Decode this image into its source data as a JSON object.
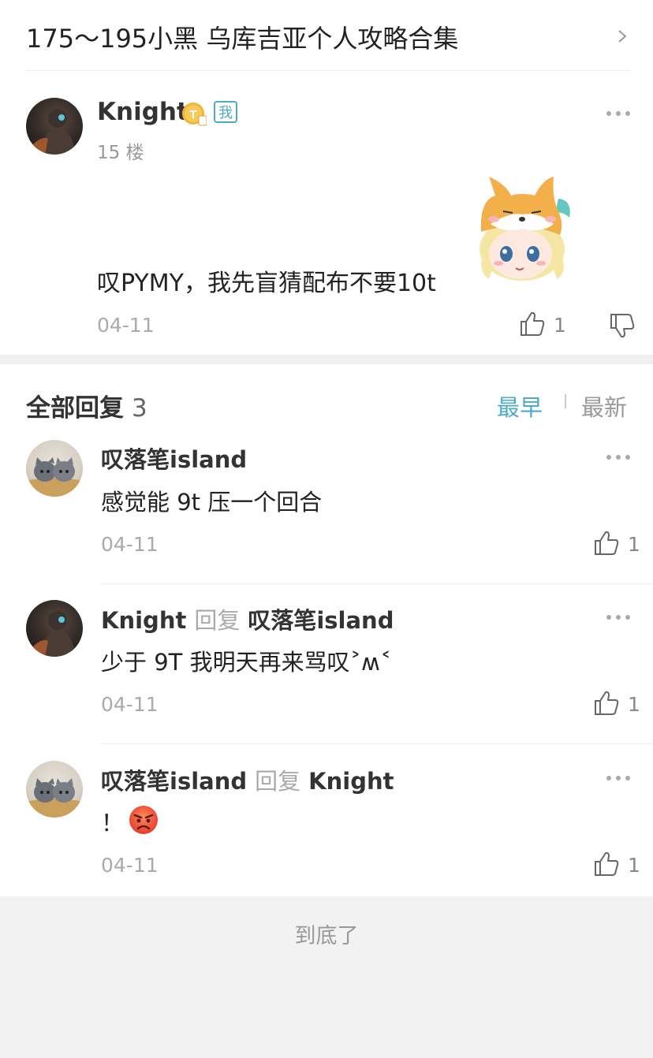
{
  "thread": {
    "title": "175～195小黑 乌库吉亚个人攻略合集"
  },
  "post": {
    "username": "Knight",
    "level_badge": "T",
    "self_badge": "我",
    "floor": "15 楼",
    "text": "叹PYMY，我先盲猜配布不要10t",
    "date": "04-11",
    "likes": "1",
    "sticker": "shiba-hat-girl-sticker"
  },
  "replies": {
    "title": "全部回复",
    "count": "3",
    "sort_earliest": "最早",
    "sort_latest": "最新",
    "items": [
      {
        "author": "叹落笔island",
        "reply_word": "",
        "reply_to": "",
        "text": "感觉能 9t 压一个回合",
        "date": "04-11",
        "likes": "1"
      },
      {
        "author": "Knight",
        "reply_word": "回复",
        "reply_to": "叹落笔island",
        "text": "少于 9T 我明天再来骂叹˃ʍ˂",
        "date": "04-11",
        "likes": "1"
      },
      {
        "author": "叹落笔island",
        "reply_word": "回复",
        "reply_to": "Knight",
        "text": "！",
        "emoji": "angry-face-emoji",
        "date": "04-11",
        "likes": "1"
      }
    ]
  },
  "footer": {
    "end_text": "到底了"
  },
  "colors": {
    "accent": "#4dabc7",
    "muted": "#999999",
    "background": "#f2f2f2"
  }
}
